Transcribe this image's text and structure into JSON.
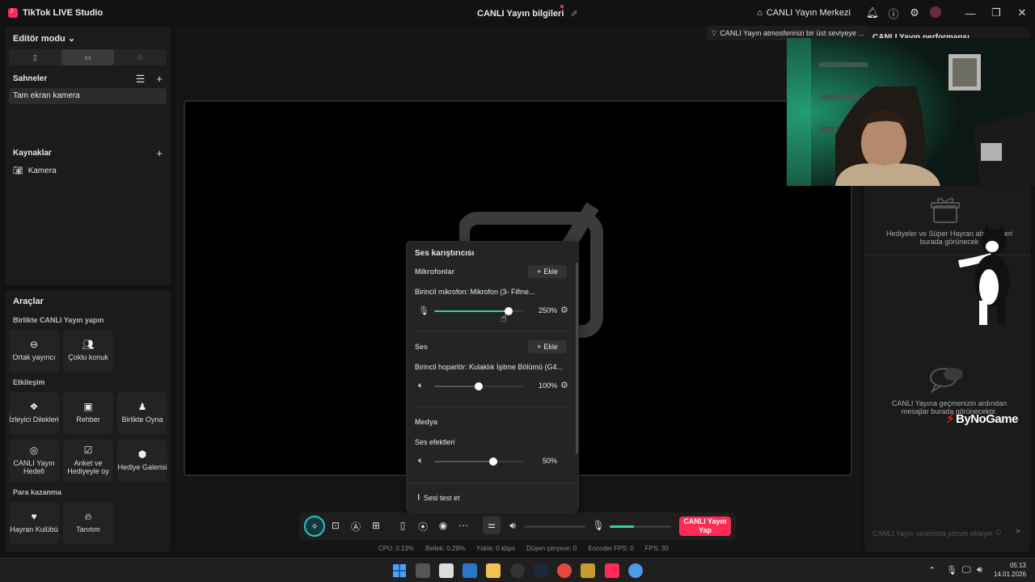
{
  "app": {
    "title": "TikTok LIVE Studio",
    "center_title": "CANLI Yayın bilgileri",
    "live_center": "CANLI Yayın Merkezi"
  },
  "editor": {
    "mode_label": "Editör modu",
    "scenes_label": "Sahneler",
    "scenes": [
      "Tam ekran kamera"
    ],
    "sources_label": "Kaynaklar",
    "sources": [
      "Kamera"
    ]
  },
  "tools": {
    "title": "Araçlar",
    "groups": [
      {
        "label": "Birlikte CANLI Yayın yapın",
        "items": [
          {
            "label": "Ortak yayıncı",
            "icon": "link-icon"
          },
          {
            "label": "Çoklu konuk",
            "icon": "users-icon"
          }
        ]
      },
      {
        "label": "Etkileşim",
        "items": [
          {
            "label": "İzleyici Dilekleri",
            "icon": "wish-icon"
          },
          {
            "label": "Rehber",
            "icon": "guide-icon"
          },
          {
            "label": "Birlikte Oyna",
            "icon": "play-together-icon"
          },
          {
            "label": "CANLI Yayın Hedefi",
            "icon": "goal-icon"
          },
          {
            "label": "Anket ve Hediyeyle oy",
            "icon": "poll-icon"
          },
          {
            "label": "Hediye Galerisi",
            "icon": "gift-gallery-icon"
          }
        ]
      },
      {
        "label": "Para kazanma",
        "items": [
          {
            "label": "Hayran Kulübü",
            "icon": "heart-icon"
          },
          {
            "label": "Tanıtım",
            "icon": "flame-icon"
          }
        ]
      }
    ]
  },
  "tip": "CANLI Yayın atmosferinizi bir üst seviyeye ...",
  "right_panel": {
    "title": "CANLI Yayın performansı",
    "gifts_text": "Hediyeler ve Süper Hayran abonelikleri burada görünecek",
    "chat_text": "CANLI Yayına geçmenizin ardından mesajlar burada görünecektir.",
    "chat_placeholder": "CANLI Yayın sırasında yorum ekleyin"
  },
  "watermark": "ByNoGame",
  "mixer": {
    "title": "Ses karıştırıcısı",
    "add_label": "Ekle",
    "mic_section": "Mikrofonlar",
    "mic_device": "Birincil mikrofon: Mikrofon (3- Fifine...",
    "mic_level": 250,
    "mic_pct": "250%",
    "audio_section": "Ses",
    "speaker_device": "Birincil hoparlör: Kulaklık İşitme Bölümü (G4...",
    "speaker_level": 100,
    "speaker_pct": "100%",
    "media_section": "Medya",
    "effects_label": "Ses efektleri",
    "effects_level": 50,
    "effects_pct": "50%",
    "test_label": "Sesi test et"
  },
  "bottom_bar": {
    "go_live": "CANLI Yayın Yap",
    "speaker_level": 0,
    "mic_level": 0.4
  },
  "status": {
    "cpu": "CPU: 0.13%",
    "memory": "Bellek: 0.29%",
    "upload": "Yükle: 0 kbps",
    "dropped": "Düşen çerçeve: 0",
    "encoder": "Encoder FPS: 0",
    "fps": "FPS: 30"
  },
  "taskbar": {
    "time": "05:13",
    "date": "14.01.2026"
  },
  "colors": {
    "accent": "#fe2c55",
    "teal": "#23c7c7",
    "meter": "#30d6a0"
  }
}
